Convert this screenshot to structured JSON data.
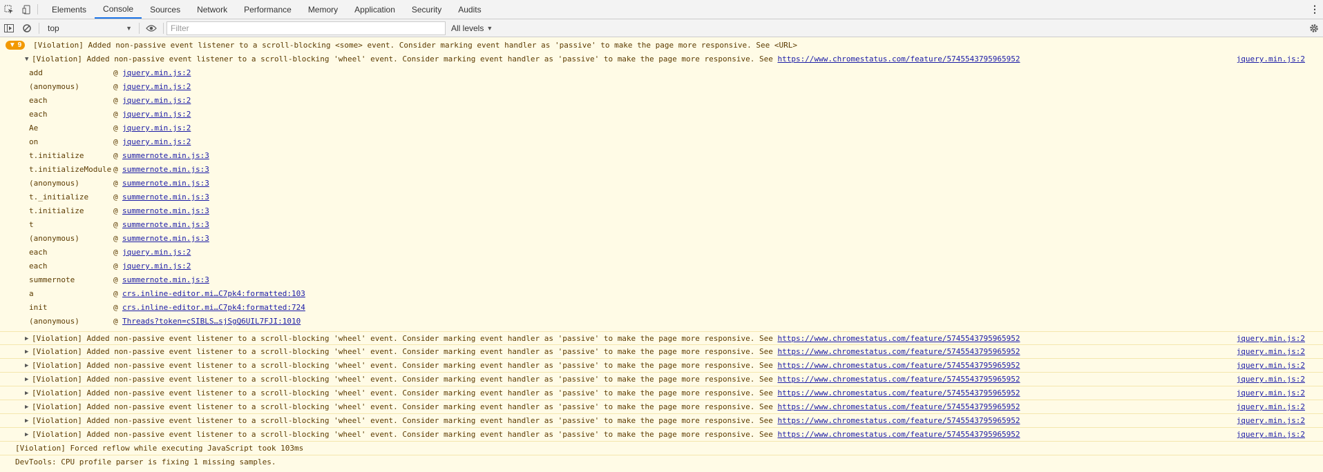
{
  "tabs": [
    "Elements",
    "Console",
    "Sources",
    "Network",
    "Performance",
    "Memory",
    "Application",
    "Security",
    "Audits"
  ],
  "toolbar": {
    "context": "top",
    "filter_placeholder": "Filter",
    "levels": "All levels"
  },
  "console": {
    "group_count": "9",
    "group_summary": "[Violation] Added non-passive event listener to a scroll-blocking <some> event. Consider marking event handler as 'passive' to make the page more responsive. See <URL>",
    "expanded": {
      "message": "[Violation] Added non-passive event listener to a scroll-blocking 'wheel' event. Consider marking event handler as 'passive' to make the page more responsive. See ",
      "url": "https://www.chromestatus.com/feature/5745543795965952",
      "source": "jquery.min.js:2"
    },
    "stack": [
      {
        "fn": "add",
        "src": "jquery.min.js:2"
      },
      {
        "fn": "(anonymous)",
        "src": "jquery.min.js:2"
      },
      {
        "fn": "each",
        "src": "jquery.min.js:2"
      },
      {
        "fn": "each",
        "src": "jquery.min.js:2"
      },
      {
        "fn": "Ae",
        "src": "jquery.min.js:2"
      },
      {
        "fn": "on",
        "src": "jquery.min.js:2"
      },
      {
        "fn": "t.initialize",
        "src": "summernote.min.js:3"
      },
      {
        "fn": "t.initializeModule",
        "src": "summernote.min.js:3"
      },
      {
        "fn": "(anonymous)",
        "src": "summernote.min.js:3"
      },
      {
        "fn": "t._initialize",
        "src": "summernote.min.js:3"
      },
      {
        "fn": "t.initialize",
        "src": "summernote.min.js:3"
      },
      {
        "fn": "t",
        "src": "summernote.min.js:3"
      },
      {
        "fn": "(anonymous)",
        "src": "summernote.min.js:3"
      },
      {
        "fn": "each",
        "src": "jquery.min.js:2"
      },
      {
        "fn": "each",
        "src": "jquery.min.js:2"
      },
      {
        "fn": "summernote",
        "src": "summernote.min.js:3"
      },
      {
        "fn": "a",
        "src": "crs.inline-editor.mi…C7pk4:formatted:103"
      },
      {
        "fn": "init",
        "src": "crs.inline-editor.mi…C7pk4:formatted:724"
      },
      {
        "fn": "(anonymous)",
        "src": "Threads?token=cSIBLS…sjSgQ6UIL7FJI:1010"
      }
    ],
    "at_sign": "@",
    "collapsed": [
      {
        "message": "[Violation] Added non-passive event listener to a scroll-blocking 'wheel' event. Consider marking event handler as 'passive' to make the page more responsive. See ",
        "url": "https://www.chromestatus.com/feature/5745543795965952",
        "source": "jquery.min.js:2"
      },
      {
        "message": "[Violation] Added non-passive event listener to a scroll-blocking 'wheel' event. Consider marking event handler as 'passive' to make the page more responsive. See ",
        "url": "https://www.chromestatus.com/feature/5745543795965952",
        "source": "jquery.min.js:2"
      },
      {
        "message": "[Violation] Added non-passive event listener to a scroll-blocking 'wheel' event. Consider marking event handler as 'passive' to make the page more responsive. See ",
        "url": "https://www.chromestatus.com/feature/5745543795965952",
        "source": "jquery.min.js:2"
      },
      {
        "message": "[Violation] Added non-passive event listener to a scroll-blocking 'wheel' event. Consider marking event handler as 'passive' to make the page more responsive. See ",
        "url": "https://www.chromestatus.com/feature/5745543795965952",
        "source": "jquery.min.js:2"
      },
      {
        "message": "[Violation] Added non-passive event listener to a scroll-blocking 'wheel' event. Consider marking event handler as 'passive' to make the page more responsive. See ",
        "url": "https://www.chromestatus.com/feature/5745543795965952",
        "source": "jquery.min.js:2"
      },
      {
        "message": "[Violation] Added non-passive event listener to a scroll-blocking 'wheel' event. Consider marking event handler as 'passive' to make the page more responsive. See ",
        "url": "https://www.chromestatus.com/feature/5745543795965952",
        "source": "jquery.min.js:2"
      },
      {
        "message": "[Violation] Added non-passive event listener to a scroll-blocking 'wheel' event. Consider marking event handler as 'passive' to make the page more responsive. See ",
        "url": "https://www.chromestatus.com/feature/5745543795965952",
        "source": "jquery.min.js:2"
      },
      {
        "message": "[Violation] Added non-passive event listener to a scroll-blocking 'wheel' event. Consider marking event handler as 'passive' to make the page more responsive. See ",
        "url": "https://www.chromestatus.com/feature/5745543795965952",
        "source": "jquery.min.js:2"
      }
    ],
    "reflow": "[Violation] Forced reflow while executing JavaScript took 103ms",
    "devtools": "DevTools: CPU profile parser is fixing 1 missing samples."
  }
}
